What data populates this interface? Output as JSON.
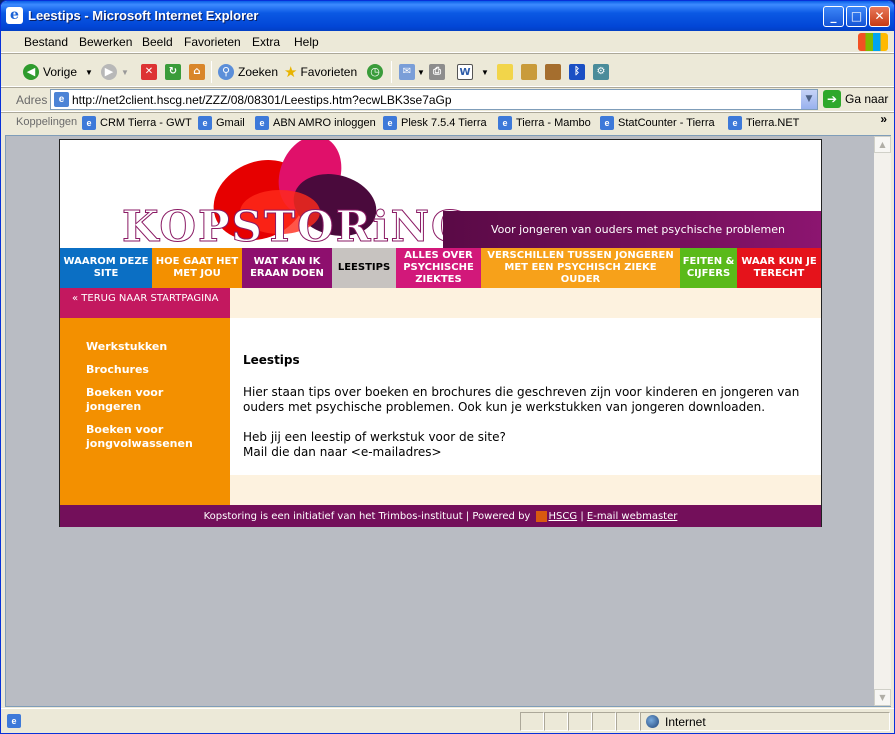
{
  "window": {
    "title": "Leestips - Microsoft Internet Explorer"
  },
  "menu": [
    "Bestand",
    "Bewerken",
    "Beeld",
    "Favorieten",
    "Extra",
    "Help"
  ],
  "toolbar": {
    "back": "Vorige",
    "search": "Zoeken",
    "favorites": "Favorieten"
  },
  "address": {
    "label": "Adres",
    "url": "http://net2client.hscg.net/ZZZ/08/08301/Leestips.htm?ecwLBK3se7aGp",
    "go": "Ga naar"
  },
  "links": {
    "label": "Koppelingen",
    "items": [
      "CRM Tierra - GWT",
      "Gmail",
      "ABN AMRO inloggen",
      "Plesk 7.5.4 Tierra",
      "Tierra - Mambo",
      "StatCounter - Tierra",
      "Tierra.NET"
    ]
  },
  "site": {
    "logo": "KOPSTORiNG",
    "tagline": "Voor jongeren van ouders met psychische problemen",
    "nav": [
      {
        "label": "WAAROM DEZE SITE",
        "color": "#0b6fc4"
      },
      {
        "label": "HOE GAAT HET MET JOU",
        "color": "#f39000"
      },
      {
        "label": "WAT KAN IK ERAAN DOEN",
        "color": "#8e0f6e"
      },
      {
        "label": "LEESTIPS",
        "color": "#c7c3c0"
      },
      {
        "label": "ALLES OVER PSYCHISCHE ZIEKTES",
        "color": "#d2187a"
      },
      {
        "label": "VERSCHILLEN TUSSEN JONGEREN MET EEN PSYCHISCH ZIEKE OUDER",
        "color": "#f7a11a"
      },
      {
        "label": "FEITEN & CIJFERS",
        "color": "#5aba1a"
      },
      {
        "label": "WAAR KUN JE TERECHT",
        "color": "#e5131b"
      }
    ],
    "back": "« TERUG NAAR STARTPAGINA",
    "side": [
      "Werkstukken",
      "Brochures",
      "Boeken voor jongeren",
      "Boeken voor jongvolwassenen"
    ],
    "content": {
      "title": "Leestips",
      "p1": "Hier staan tips over boeken en brochures die geschreven zijn voor kinderen en jongeren van ouders met psychische problemen. Ook kun je werkstukken van jongeren downloaden.",
      "p2a": "Heb jij een leestip of werkstuk voor de site?",
      "p2b": "Mail die dan naar <e-mailadres>"
    },
    "footer": {
      "text": "Kopstoring is een initiatief van het Trimbos-instituut | Powered by",
      "hscg": "HSCG",
      "sep": "|",
      "email": "E-mail webmaster"
    }
  },
  "status": {
    "zone": "Internet"
  }
}
